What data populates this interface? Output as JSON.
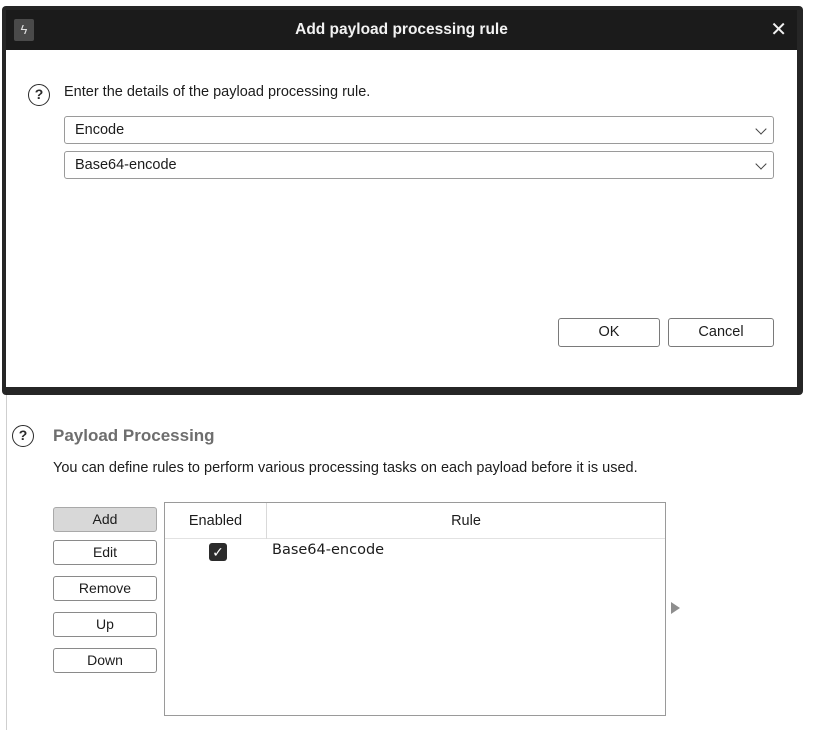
{
  "dialog": {
    "title": "Add payload processing rule",
    "close_glyph": "✕",
    "app_icon_glyph": "ϟ",
    "description": "Enter the details of the payload processing rule.",
    "help_glyph": "?",
    "rule_type_select": {
      "selected": "Encode"
    },
    "rule_option_select": {
      "selected": "Base64-encode"
    },
    "ok_label": "OK",
    "cancel_label": "Cancel"
  },
  "payload_processing": {
    "help_glyph": "?",
    "title": "Payload Processing",
    "description": "You can define rules to perform various processing tasks on each payload before it is used.",
    "buttons": {
      "add": "Add",
      "edit": "Edit",
      "remove": "Remove",
      "up": "Up",
      "down": "Down"
    },
    "table": {
      "columns": [
        "Enabled",
        "Rule"
      ],
      "rows": [
        {
          "enabled": true,
          "check_glyph": "✓",
          "rule": "Base64-encode"
        }
      ]
    }
  },
  "icons": {
    "help": "question-circle-icon",
    "close": "close-icon",
    "dropdown": "chevron-down-icon",
    "expand": "triangle-right-icon",
    "app": "lightning-icon"
  },
  "colors": {
    "titlebar": "#1b1b1b",
    "dialog_border": "#1a1a1a",
    "pressed_button": "#d8d8d8",
    "section_title": "#6e6e6e"
  }
}
